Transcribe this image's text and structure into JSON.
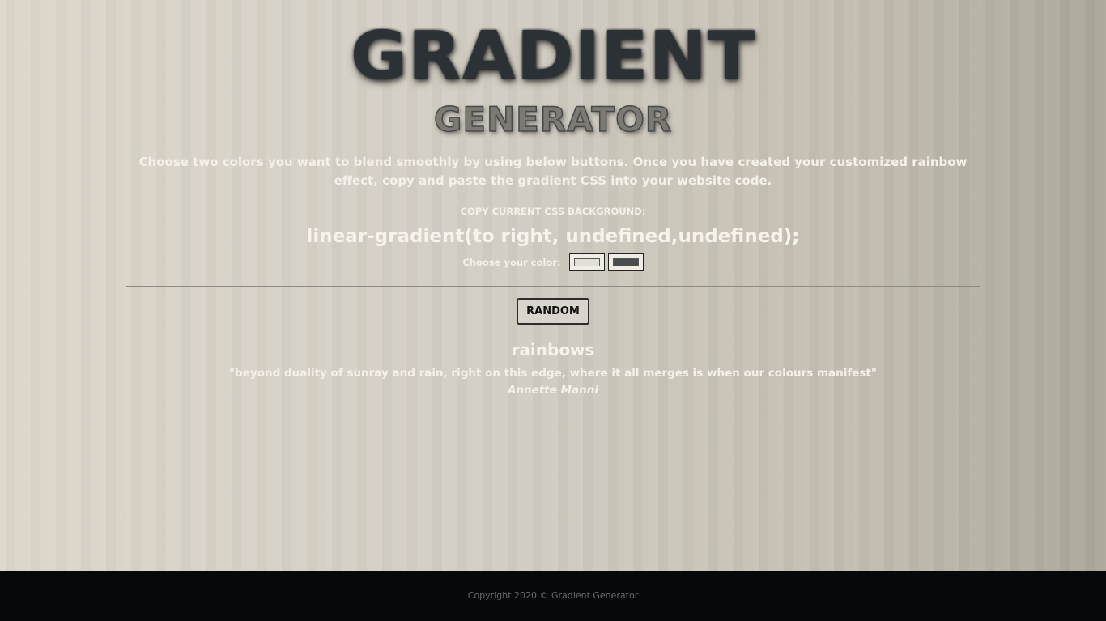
{
  "header": {
    "title": "GRADIENT",
    "subtitle": "GENERATOR"
  },
  "intro": {
    "text": "Choose two colors you want to blend smoothly by using below buttons. Once you have created your customized rainbow effect, copy and paste the gradient CSS into your website code."
  },
  "css_output": {
    "label": "COPY CURRENT CSS BACKGROUND:",
    "value": "linear-gradient(to right, undefined,undefined);"
  },
  "color_picker": {
    "label": "Choose your color:",
    "color1": "#e2dfd8",
    "color2": "#4a4d4f"
  },
  "actions": {
    "random_label": "RANDOM"
  },
  "quote": {
    "title": "rainbows",
    "text": "\"beyond duality of sunray and rain, right on this edge, where it all merges is when our colours manifest\"",
    "author": "Annette Manni"
  },
  "footer": {
    "copyright": "Copyright 2020 © Gradient Generator"
  },
  "colors": {
    "title_dark": "#2b3134",
    "footer_bg": "#06090b",
    "page_gradient_start": "#dcd6cb",
    "page_gradient_end": "#aaa699"
  }
}
